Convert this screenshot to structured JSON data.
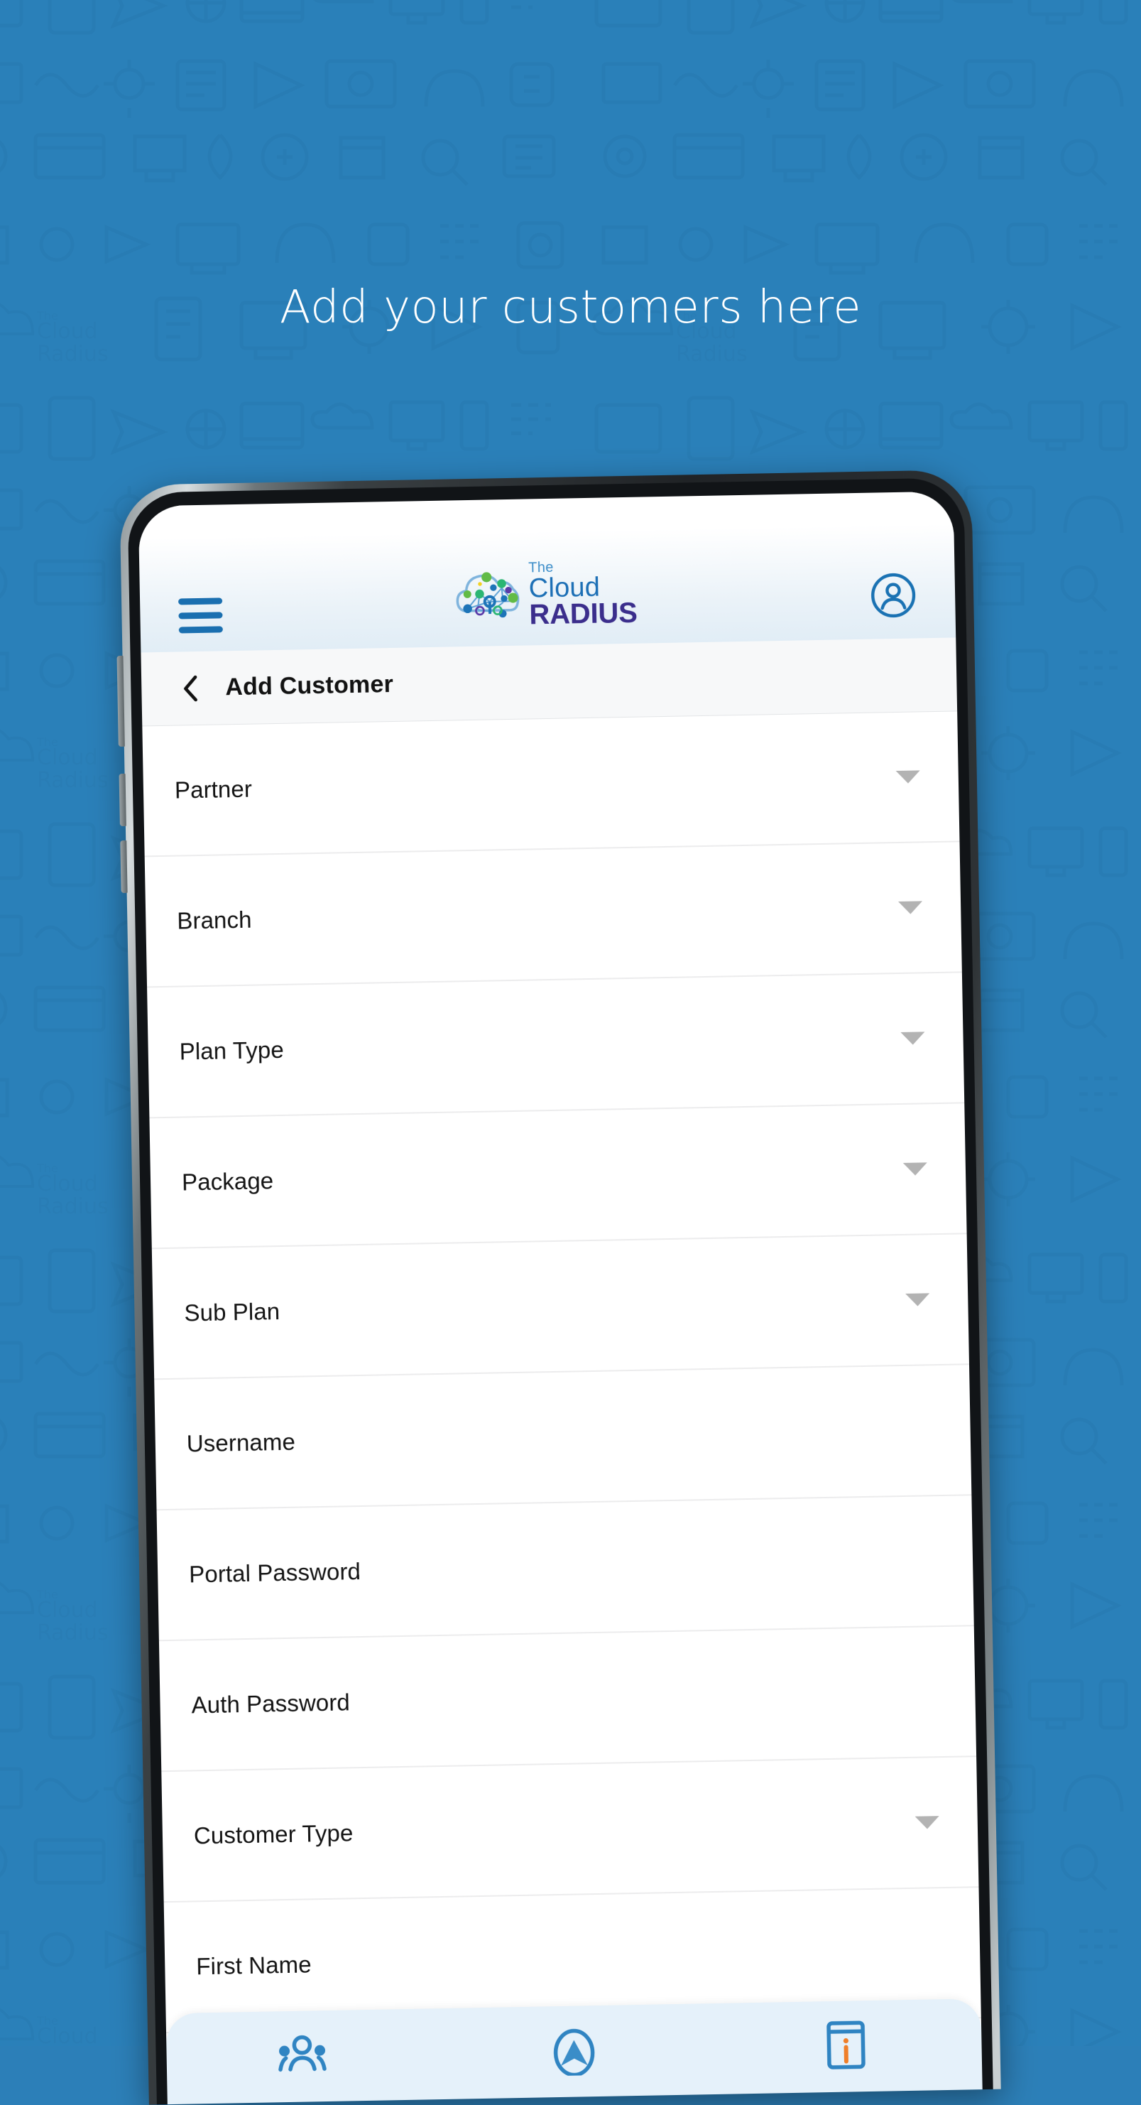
{
  "page": {
    "headline": "Add your customers here",
    "background_color": "#2b80b9",
    "background_watermark_text_line1": "The Cloud",
    "background_watermark_text_line2": "Radius"
  },
  "app": {
    "header": {
      "menu_icon": "hamburger-menu-icon",
      "logo": {
        "the": "The",
        "cloud": "Cloud",
        "radius": "RADIUS",
        "mark": "cloud-network-logo-icon"
      },
      "account_icon": "user-account-icon",
      "accent_blue": "#1c6fb5",
      "accent_purple": "#3b2e8c"
    },
    "subheader": {
      "back_icon": "back-chevron-icon",
      "title": "Add Customer"
    },
    "form": {
      "fields": [
        {
          "label": "Partner",
          "type": "select"
        },
        {
          "label": "Branch",
          "type": "select"
        },
        {
          "label": "Plan Type",
          "type": "select"
        },
        {
          "label": "Package",
          "type": "select"
        },
        {
          "label": "Sub Plan",
          "type": "select"
        },
        {
          "label": "Username",
          "type": "text"
        },
        {
          "label": "Portal Password",
          "type": "text"
        },
        {
          "label": "Auth Password",
          "type": "text"
        },
        {
          "label": "Customer Type",
          "type": "select"
        },
        {
          "label": "First Name",
          "type": "text"
        }
      ]
    },
    "bottom_nav": {
      "items": [
        {
          "icon": "customers-group-icon"
        },
        {
          "icon": "upload-arrow-circle-icon"
        },
        {
          "icon": "info-document-icon"
        }
      ],
      "background": "#e5f1fa",
      "icon_color": "#3a8dc8",
      "info_accent": "#ef7f2a"
    }
  }
}
